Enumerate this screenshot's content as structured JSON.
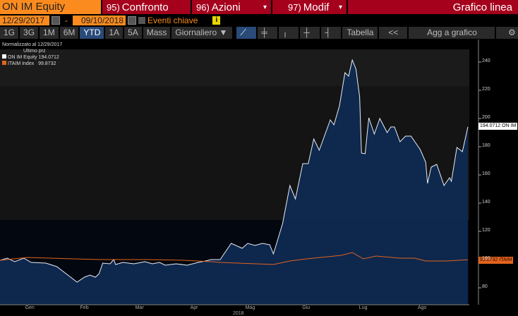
{
  "header": {
    "security": "ON IM Equity",
    "confronto": {
      "num": "95)",
      "label": "Confronto"
    },
    "azioni": {
      "num": "96)",
      "label": "Azioni"
    },
    "modif": {
      "num": "97)",
      "label": "Modif"
    },
    "chart_type": "Grafico linea",
    "dropdown": "▾"
  },
  "dates": {
    "start": "12/29/2017",
    "sep": "-",
    "end": "09/10/2018",
    "key_events": "Eventi chiave",
    "info": "i"
  },
  "toolbar": {
    "ranges": [
      "1G",
      "3G",
      "1M",
      "6M",
      "YTD",
      "1A",
      "5A",
      "Mass"
    ],
    "active": "YTD",
    "period": "Giornaliero ▼",
    "table": "Tabella",
    "collapse": "<<",
    "add": "Agg a grafico",
    "settings": "⚙"
  },
  "legend": {
    "title": "Normalizzato al 12/29/2017",
    "subtitle": "Ultimo prz",
    "items": [
      {
        "name": "ON IM Equity",
        "value": "194.0712"
      },
      {
        "name": "ITAIM Index",
        "value": "99.8732"
      }
    ]
  },
  "colors": {
    "on": "#e8eef8",
    "itaim": "#e0641e",
    "fill": "#0f2a52"
  },
  "chart_data": {
    "type": "area",
    "title": "",
    "xlabel": "2018",
    "ylabel": "",
    "x_unit": "days since 12/29/2017",
    "xlim": [
      0,
      255
    ],
    "ylim": [
      69,
      254
    ],
    "yticks": [
      80,
      100,
      120,
      140,
      160,
      180,
      200,
      220,
      240
    ],
    "ytick_labels": [
      "80",
      "100",
      "120",
      "140",
      "160",
      "180",
      "200",
      "220",
      "240"
    ],
    "months": [
      {
        "label": "Gen",
        "day": 16
      },
      {
        "label": "Feb",
        "day": 46
      },
      {
        "label": "Mar",
        "day": 76
      },
      {
        "label": "Apr",
        "day": 106
      },
      {
        "label": "Mag",
        "day": 136
      },
      {
        "label": "Giu",
        "day": 167
      },
      {
        "label": "Lug",
        "day": 198
      },
      {
        "label": "Ago",
        "day": 230
      }
    ],
    "series": [
      {
        "name": "ON IM Equity",
        "last_label": "194.0712 ON IM",
        "points": [
          [
            0,
            99.5
          ],
          [
            4,
            101
          ],
          [
            8,
            98.5
          ],
          [
            13,
            101
          ],
          [
            17,
            98
          ],
          [
            25,
            97.5
          ],
          [
            31,
            95
          ],
          [
            37,
            89
          ],
          [
            42,
            84
          ],
          [
            46,
            87.5
          ],
          [
            49,
            89
          ],
          [
            52,
            87.5
          ],
          [
            54,
            90
          ],
          [
            56,
            97.5
          ],
          [
            60,
            97
          ],
          [
            62,
            100
          ],
          [
            63,
            96.5
          ],
          [
            67,
            98
          ],
          [
            73,
            97
          ],
          [
            79,
            98.5
          ],
          [
            83,
            97
          ],
          [
            87,
            98
          ],
          [
            90,
            96
          ],
          [
            96,
            97
          ],
          [
            102,
            96
          ],
          [
            108,
            98
          ],
          [
            112,
            99
          ],
          [
            115,
            100
          ],
          [
            120,
            100
          ],
          [
            126,
            111.5
          ],
          [
            132,
            108
          ],
          [
            135,
            111.5
          ],
          [
            139,
            110
          ],
          [
            143,
            111.5
          ],
          [
            147,
            110.5
          ],
          [
            149,
            104
          ],
          [
            154,
            125.5
          ],
          [
            158,
            152.5
          ],
          [
            161,
            143
          ],
          [
            165,
            168
          ],
          [
            168,
            168
          ],
          [
            171,
            185.5
          ],
          [
            174,
            177.5
          ],
          [
            180,
            199
          ],
          [
            182,
            195.5
          ],
          [
            185,
            209
          ],
          [
            188,
            232.5
          ],
          [
            190,
            230
          ],
          [
            192,
            241.5
          ],
          [
            194,
            235
          ],
          [
            196,
            215.5
          ],
          [
            197,
            175.5
          ],
          [
            199,
            175
          ],
          [
            201,
            200.5
          ],
          [
            204,
            189
          ],
          [
            207,
            200
          ],
          [
            211,
            190
          ],
          [
            213,
            194
          ],
          [
            215,
            194
          ],
          [
            218,
            183.5
          ],
          [
            221,
            187.5
          ],
          [
            224,
            187.5
          ],
          [
            229,
            178
          ],
          [
            232,
            169
          ],
          [
            233,
            154
          ],
          [
            235,
            165.5
          ],
          [
            238,
            167.5
          ],
          [
            242,
            152.5
          ],
          [
            245,
            158
          ],
          [
            246,
            155.5
          ],
          [
            249,
            179.5
          ],
          [
            252,
            176.5
          ],
          [
            255,
            194.07
          ]
        ]
      },
      {
        "name": "ITAIM Index",
        "last_label": "99.8732 ITAIM",
        "points": [
          [
            0,
            99.5
          ],
          [
            15,
            101.5
          ],
          [
            40,
            100.5
          ],
          [
            55,
            100
          ],
          [
            80,
            100
          ],
          [
            100,
            99.5
          ],
          [
            115,
            98.5
          ],
          [
            120,
            98
          ],
          [
            149,
            96.5
          ],
          [
            158,
            99
          ],
          [
            167,
            100.5
          ],
          [
            186,
            103
          ],
          [
            192,
            105
          ],
          [
            198,
            100.5
          ],
          [
            205,
            102.5
          ],
          [
            218,
            101
          ],
          [
            226,
            101
          ],
          [
            232,
            99
          ],
          [
            243,
            99
          ],
          [
            255,
            99.87
          ]
        ]
      }
    ]
  }
}
